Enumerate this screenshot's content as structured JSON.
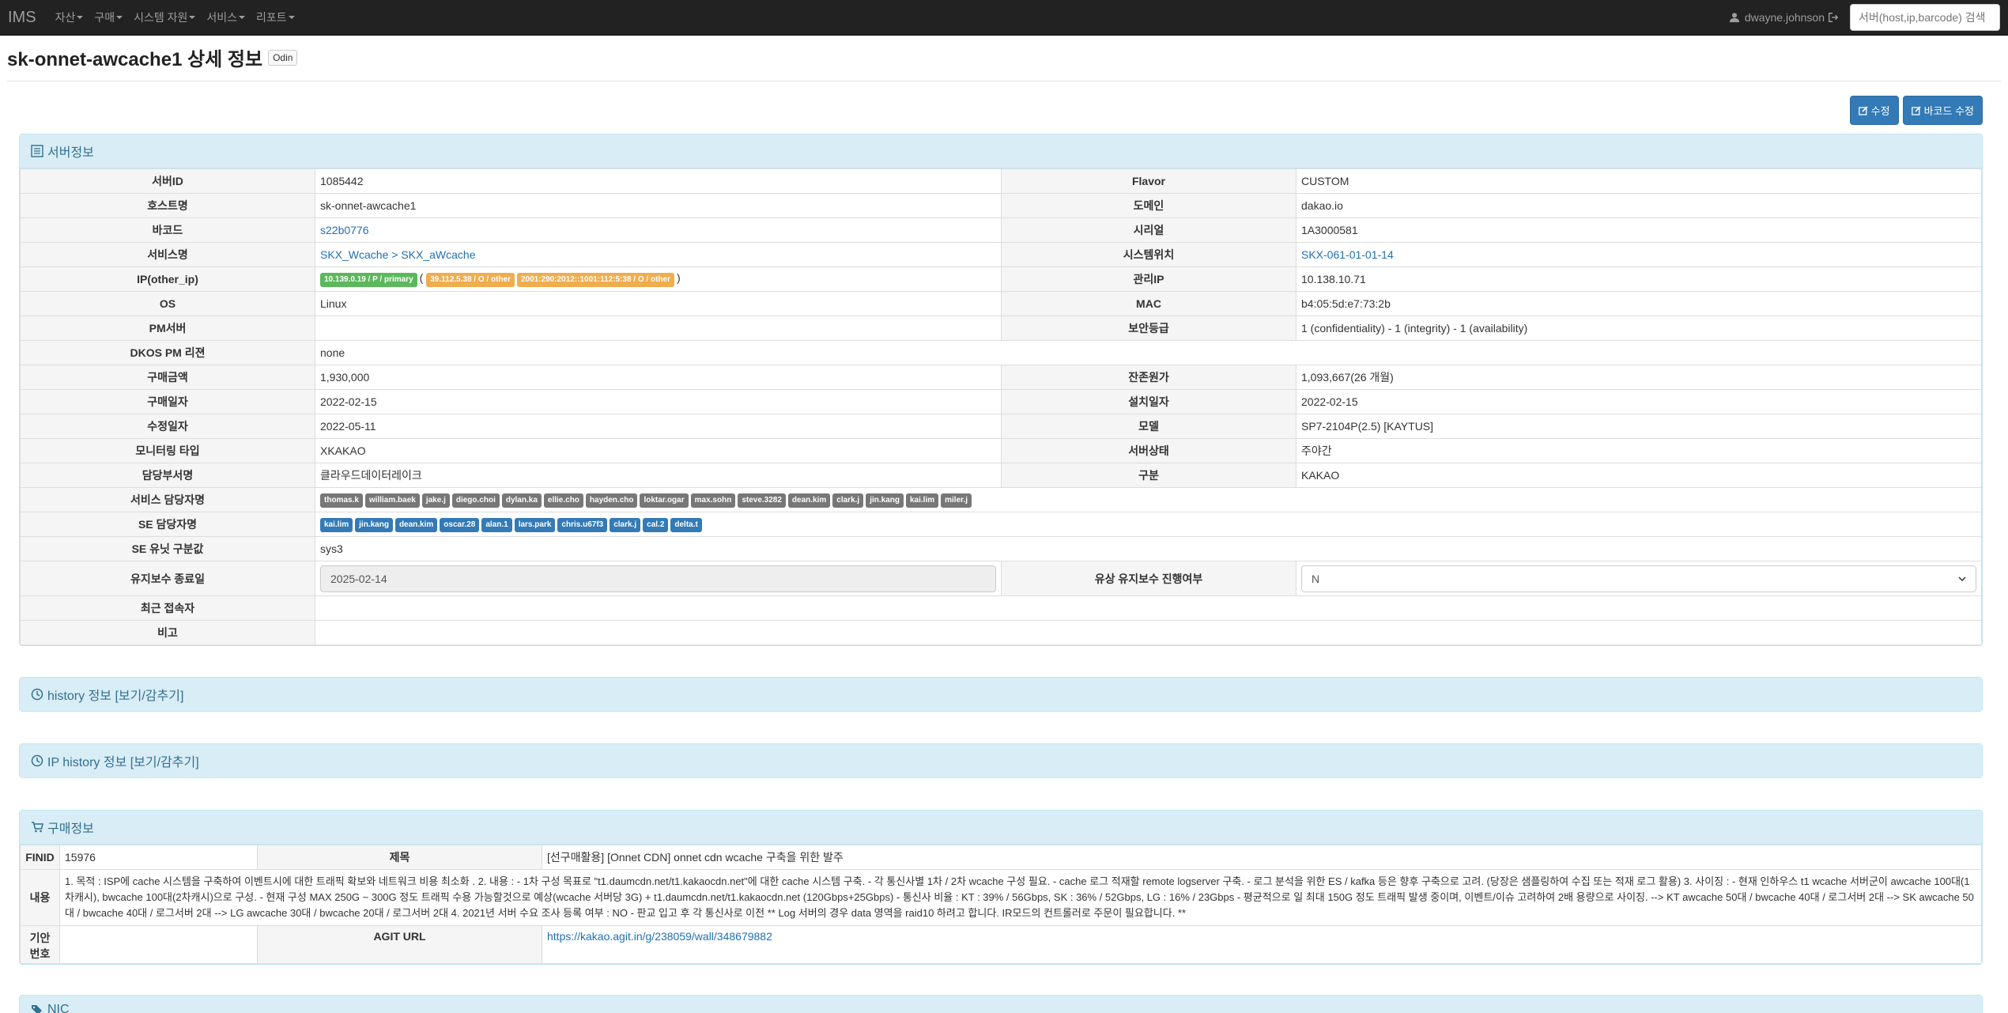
{
  "nav": {
    "brand": "IMS",
    "menu": [
      "자산",
      "구매",
      "시스템 자원",
      "서비스",
      "리포트"
    ],
    "user": "dwayne.johnson",
    "search_placeholder": "서버(host,ip,barcode) 검색"
  },
  "page": {
    "title": "sk-onnet-awcache1 상세 정보",
    "badge": "Odin"
  },
  "actions": {
    "edit": "수정",
    "barcode_edit": "바코드 수정"
  },
  "server": {
    "heading": "서버정보",
    "labels": {
      "server_id": "서버ID",
      "flavor": "Flavor",
      "hostname": "호스트명",
      "domain": "도메인",
      "barcode": "바코드",
      "serial": "시리얼",
      "service": "서비스명",
      "location": "시스템위치",
      "ip": "IP(other_ip)",
      "mgmt_ip": "관리IP",
      "os": "OS",
      "mac": "MAC",
      "pm": "PM서버",
      "security": "보안등급",
      "dkos": "DKOS PM 리젼",
      "price": "구매금액",
      "residual": "잔존원가",
      "purchase_date": "구매일자",
      "install_date": "설치일자",
      "modified_date": "수정일자",
      "model": "모델",
      "monitor": "모니터링 타입",
      "status": "서버상태",
      "dept": "담당부서명",
      "category": "구분",
      "svc_owners": "서비스 담당자명",
      "se_owners": "SE 담당자명",
      "se_unit": "SE 유닛 구분값",
      "maint_end": "유지보수 종료일",
      "paid_maint": "유상 유지보수 진행여부",
      "last_access": "최근 접속자",
      "note": "비고"
    },
    "values": {
      "server_id": "1085442",
      "flavor": "CUSTOM",
      "hostname": "sk-onnet-awcache1",
      "domain": "dakao.io",
      "barcode": "s22b0776",
      "serial": "1A3000581",
      "service": "SKX_Wcache > SKX_aWcache",
      "location": "SKX-061-01-01-14",
      "ip_primary": "10.139.0.19 / P / primary",
      "ip_paren_open": "(",
      "ip_other1": "39.112.5.38 / O / other",
      "ip_other2": "2001:290:2012::1001:112:5:38 / O / other",
      "ip_paren_close": ")",
      "mgmt_ip": "10.138.10.71",
      "os": "Linux",
      "mac": "b4:05:5d:e7:73:2b",
      "pm": "",
      "security": "1 (confidentiality) - 1 (integrity) - 1 (availability)",
      "dkos": "none",
      "price": "1,930,000",
      "residual": "1,093,667(26 개월)",
      "purchase_date": "2022-02-15",
      "install_date": "2022-02-15",
      "modified_date": "2022-05-11",
      "model": "SP7-2104P(2.5) [KAYTUS]",
      "monitor": "XKAKAO",
      "status": "주야간",
      "dept": "클라우드데이터레이크",
      "category": "KAKAO",
      "svc_owners": [
        "thomas.k",
        "william.baek",
        "jake.j",
        "diego.choi",
        "dylan.ka",
        "ellie.cho",
        "hayden.cho",
        "loktar.ogar",
        "max.sohn",
        "steve.3282",
        "dean.kim",
        "clark.j",
        "jin.kang",
        "kai.lim",
        "miler.j"
      ],
      "se_owners": [
        "kai.lim",
        "jin.kang",
        "dean.kim",
        "oscar.28",
        "alan.1",
        "lars.park",
        "chris.u67f3",
        "clark.j",
        "cal.2",
        "delta.t"
      ],
      "se_unit": "sys3",
      "maint_end": "2025-02-14",
      "paid_maint": "N",
      "last_access": "",
      "note": ""
    }
  },
  "history": {
    "heading": "history 정보 [보기/감추기]"
  },
  "ip_history": {
    "heading": "IP history 정보 [보기/감추기]"
  },
  "purchase": {
    "heading": "구매정보",
    "labels": {
      "finid": "FINID",
      "title": "제목",
      "content": "내용",
      "doc_no": "기안번호",
      "agit": "AGIT URL"
    },
    "finid": "15976",
    "title": "[선구매활용] [Onnet CDN] onnet cdn wcache 구축을 위한 발주",
    "content": "1. 목적 : ISP에 cache 시스템을 구축하여 이벤트시에 대한 트래픽 확보와 네트워크 비용 최소화 . 2. 내용 : - 1차 구성 목표로 \"t1.daumcdn.net/t1.kakaocdn.net\"에 대한 cache 시스템 구축. - 각 통신사별 1차 / 2차 wcache 구성 필요. - cache 로그 적재할 remote logserver 구축. - 로그 분석을 위한 ES / kafka 등은 향후 구축으로 고려. (당장은 샘플링하여 수집 또는 적재 로그 활용) 3. 사이징 : - 현재 인하우스 t1 wcache 서버군이 awcache 100대(1차캐시), bwcache 100대(2차캐시)으로 구성. - 현재 구성 MAX 250G ~ 300G 정도 트래픽 수용 가능할것으로 예상(wcache 서버당 3G) + t1.daumcdn.net/t1.kakaocdn.net (120Gbps+25Gbps) - 통신사 비율 : KT : 39% / 56Gbps, SK : 36% / 52Gbps, LG : 16% / 23Gbps - 평균적으로 일 최대 150G 정도 트래픽 발생 중이며, 이벤트/이슈 고려하여 2배 용량으로 사이징. --> KT awcache 50대 / bwcache 40대 / 로그서버 2대 --> SK awcache 50대 / bwcache 40대 / 로그서버 2대 --> LG awcache 30대 / bwcache 20대 / 로그서버 2대 4. 2021년 서버 수요 조사 등록 여부 : NO - 판교 입고 후 각 통신사로 이전 ** Log 서버의 경우 data 영역을 raid10 하려고 합니다. IR모드의 컨트롤러로 주문이 필요합니다. **",
    "doc_no": "",
    "agit_url": "https://kakao.agit.in/g/238059/wall/348679882"
  },
  "nic": {
    "heading": "NIC"
  }
}
